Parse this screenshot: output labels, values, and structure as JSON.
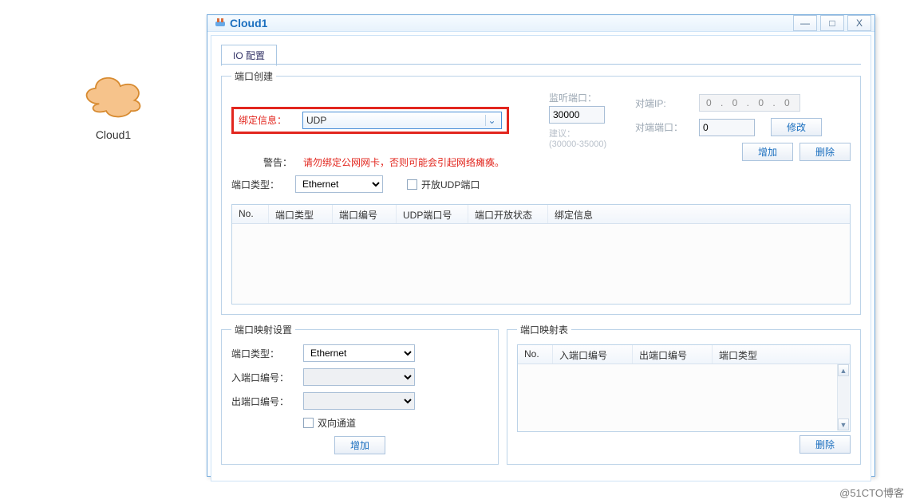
{
  "cloud_label": "Cloud1",
  "window": {
    "title": "Cloud1"
  },
  "tab": {
    "io_config": "IO 配置"
  },
  "port_create": {
    "legend": "端口创建",
    "bind_info_label": "绑定信息：",
    "bind_info_value": "UDP",
    "warn_label": "警告：",
    "warn_text": "请勿绑定公网网卡，否则可能会引起网络瘫痪。",
    "port_type_label": "端口类型：",
    "port_type_value": "Ethernet",
    "open_udp_label": "开放UDP端口",
    "listen_port_label": "监听端口：",
    "listen_port_value": "30000",
    "listen_suggest_label": "建议：",
    "listen_suggest_value": "(30000-35000)",
    "peer_ip_label": "对端IP:",
    "peer_ip_value": "0 . 0 . 0 . 0",
    "peer_port_label": "对端端口：",
    "peer_port_value": "0",
    "modify_btn": "修改",
    "add_btn": "增加",
    "del_btn": "删除",
    "cols": {
      "no": "No.",
      "type": "端口类型",
      "num": "端口编号",
      "udpnum": "UDP端口号",
      "openstat": "端口开放状态",
      "bindinfo": "绑定信息"
    }
  },
  "port_map_set": {
    "legend": "端口映射设置",
    "port_type_label": "端口类型：",
    "port_type_value": "Ethernet",
    "in_port_label": "入端口编号：",
    "out_port_label": "出端口编号：",
    "bidir_label": "双向通道",
    "add_btn": "增加"
  },
  "port_map_tbl": {
    "legend": "端口映射表",
    "cols": {
      "no": "No.",
      "in": "入端口编号",
      "out": "出端口编号",
      "type": "端口类型"
    },
    "del_btn": "删除"
  },
  "watermark": "@51CTO博客"
}
